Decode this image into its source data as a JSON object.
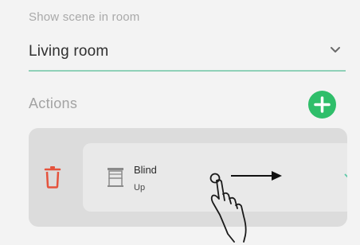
{
  "scene_room": {
    "label": "Show scene in room",
    "value": "Living room",
    "chevron_icon": "chevron-down-icon"
  },
  "actions": {
    "title": "Actions",
    "add_icon": "plus-icon",
    "add_color": "#2fbe6a",
    "items": [
      {
        "name": "Blind",
        "state": "Up",
        "icon": "blind-icon",
        "delete_icon": "trash-icon",
        "delete_color": "#e5533d",
        "chevron_icon": "chevron-down-icon",
        "chevron_color": "#5cc9a7"
      }
    ]
  },
  "gesture": {
    "type": "swipe-right",
    "icon": "hand-pointer-icon",
    "arrow_icon": "arrow-right-icon"
  },
  "colors": {
    "accent_underline": "#8fd1b8"
  }
}
